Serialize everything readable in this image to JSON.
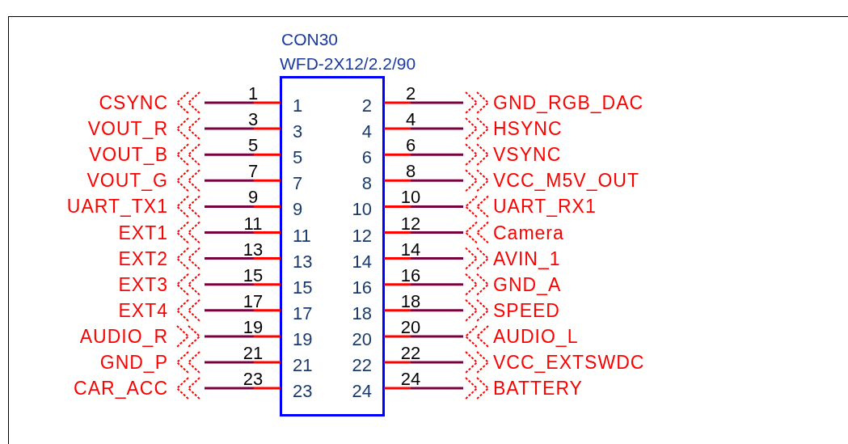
{
  "component": {
    "reference": "CON30",
    "part": "WFD-2X12/2.2/90"
  },
  "left_pins": [
    {
      "wire_number": "1",
      "box_number": "1",
      "net": "CSYNC",
      "kind": "left"
    },
    {
      "wire_number": "3",
      "box_number": "3",
      "net": "VOUT_R",
      "kind": "left"
    },
    {
      "wire_number": "5",
      "box_number": "5",
      "net": "VOUT_B",
      "kind": "left"
    },
    {
      "wire_number": "7",
      "box_number": "7",
      "net": "VOUT_G",
      "kind": "left"
    },
    {
      "wire_number": "9",
      "box_number": "9",
      "net": "UART_TX1",
      "kind": "left"
    },
    {
      "wire_number": "11",
      "box_number": "11",
      "net": "EXT1",
      "kind": "left"
    },
    {
      "wire_number": "13",
      "box_number": "13",
      "net": "EXT2",
      "kind": "left"
    },
    {
      "wire_number": "15",
      "box_number": "15",
      "net": "EXT3",
      "kind": "left"
    },
    {
      "wire_number": "17",
      "box_number": "17",
      "net": "EXT4",
      "kind": "left"
    },
    {
      "wire_number": "19",
      "box_number": "19",
      "net": "AUDIO_R",
      "kind": "right"
    },
    {
      "wire_number": "21",
      "box_number": "21",
      "net": "GND_P",
      "kind": "left"
    },
    {
      "wire_number": "23",
      "box_number": "23",
      "net": "CAR_ACC",
      "kind": "left"
    }
  ],
  "right_pins": [
    {
      "wire_number": "2",
      "box_number": "2",
      "net": "GND_RGB_DAC",
      "kind": "right"
    },
    {
      "wire_number": "4",
      "box_number": "4",
      "net": "HSYNC",
      "kind": "right"
    },
    {
      "wire_number": "6",
      "box_number": "6",
      "net": "VSYNC",
      "kind": "right"
    },
    {
      "wire_number": "8",
      "box_number": "8",
      "net": "VCC_M5V_OUT",
      "kind": "right"
    },
    {
      "wire_number": "10",
      "box_number": "10",
      "net": "UART_RX1",
      "kind": "left"
    },
    {
      "wire_number": "12",
      "box_number": "12",
      "net": "Camera",
      "kind": "left"
    },
    {
      "wire_number": "14",
      "box_number": "14",
      "net": "AVIN_1",
      "kind": "right"
    },
    {
      "wire_number": "16",
      "box_number": "16",
      "net": "GND_A",
      "kind": "right"
    },
    {
      "wire_number": "18",
      "box_number": "18",
      "net": "SPEED",
      "kind": "right"
    },
    {
      "wire_number": "20",
      "box_number": "20",
      "net": "AUDIO_L",
      "kind": "left"
    },
    {
      "wire_number": "22",
      "box_number": "22",
      "net": "VCC_EXTSWDC",
      "kind": "right"
    },
    {
      "wire_number": "24",
      "box_number": "24",
      "net": "BATTERY",
      "kind": "right"
    }
  ]
}
